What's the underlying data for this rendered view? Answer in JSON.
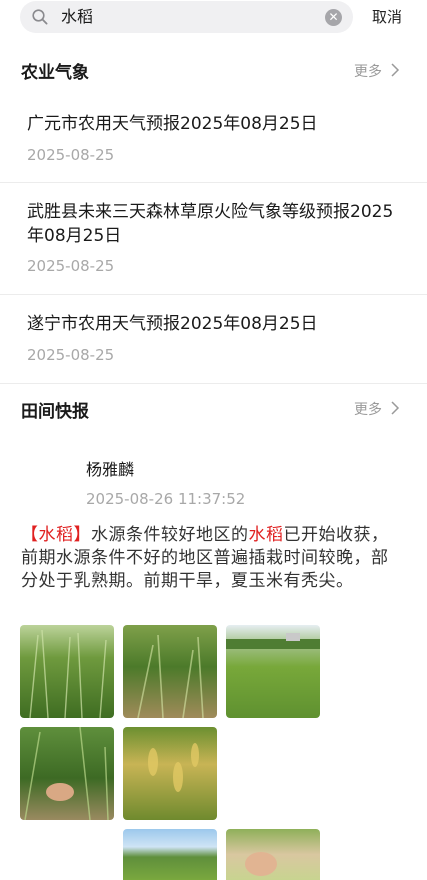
{
  "search": {
    "query": "水稻",
    "cancel_label": "取消"
  },
  "agri_weather": {
    "title": "农业气象",
    "more_label": "更多",
    "items": [
      {
        "title": "广元市农用天气预报2025年08月25日",
        "date": "2025-08-25"
      },
      {
        "title": "武胜县未来三天森林草原火险气象等级预报2025年08月25日",
        "date": "2025-08-25"
      },
      {
        "title": "遂宁市农用天气预报2025年08月25日",
        "date": "2025-08-25"
      }
    ]
  },
  "field_report": {
    "title": "田间快报",
    "more_label": "更多",
    "post": {
      "author": "杨雅麟",
      "time": "2025-08-26 11:37:52",
      "bracket_open": "【",
      "keyword": "水稻",
      "bracket_close": "】",
      "text_part1": "水源条件较好地区的",
      "text_part2": "已开始收获，前期水源条件不好的地区普遍插栽时间较晚，部分处于乳熟期。前期干旱，夏玉米有秃尖。"
    }
  },
  "colors": {
    "highlight": "#e02020",
    "muted": "#a8a8a8",
    "search_bg": "#f0f0f2"
  },
  "icons": [
    "search-icon",
    "clear-icon",
    "chevron-right-icon"
  ]
}
